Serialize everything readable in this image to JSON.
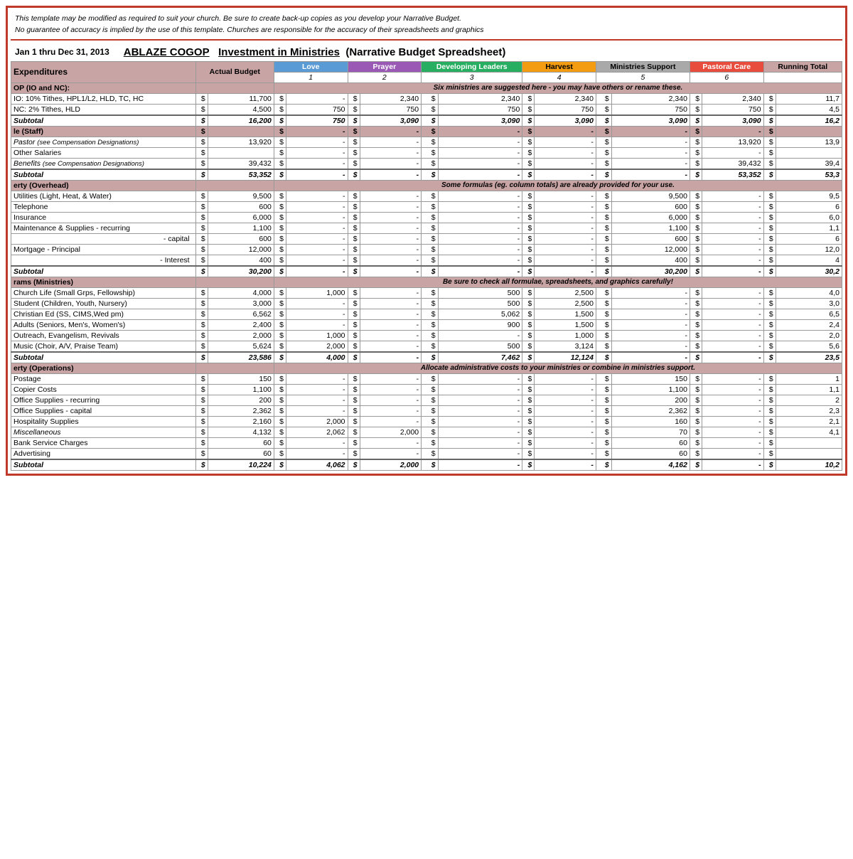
{
  "disclaimer": {
    "line1": "This template may be modified as required to suit your church.  Be sure to create back-up copies as you develop your Narrative Budget.",
    "line2": "No guarantee of accuracy is implied by the use of this template.  Churches are responsible for the accuracy of their spreadsheets and graphics"
  },
  "title": {
    "date_range": "Jan 1 thru Dec 31, 2013",
    "org": "ABLAZE COGOP",
    "subtitle": "Investment in Ministries",
    "type": "(Narrative Budget Spreadsheet)"
  },
  "headers": {
    "expenditures": "Expenditures",
    "actual_budget": "Actual Budget",
    "love": "Love",
    "love_num": "1",
    "prayer": "Prayer",
    "prayer_num": "2",
    "developing": "Developing Leaders",
    "developing_num": "3",
    "harvest": "Harvest",
    "harvest_num": "4",
    "ministries": "Ministries Support",
    "ministries_num": "5",
    "pastoral": "Pastoral Care",
    "pastoral_num": "6",
    "running": "Running Total"
  },
  "notices": {
    "op": "Six ministries are suggested here - you may have others or rename these.",
    "property": "Some formulas (eg. column totals) are already provided for your use.",
    "programs": "Be sure to check all formulae, spreadsheets, and graphics carefully!",
    "admin": "Allocate administrative costs to your ministries or combine in ministries support."
  },
  "sections": {
    "op_label": "OP (IO and NC):",
    "people_label": "le (Staff)",
    "property_label": "erty (Overhead)",
    "programs_label": "rams (Ministries)",
    "admin_label": "erty (Operations)"
  }
}
